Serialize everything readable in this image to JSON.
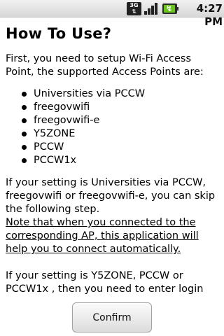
{
  "status_bar": {
    "network_type": "3G",
    "network_arrows": "⇅",
    "signal_level": 1.0,
    "battery_level": 0.95,
    "battery_color": "#69c51e",
    "time": "4:27 PM"
  },
  "page": {
    "title": "How To Use?",
    "intro": "First, you need to setup Wi-Fi Access Point, the supported Access Points are:",
    "access_points": [
      "Universities via PCCW",
      "freegovwifi",
      "freegovwifi-e",
      "Y5ZONE",
      "PCCW",
      "PCCW1x"
    ],
    "setting_universities": "If your setting is Universities via PCCW, freegovwifi or freegovwifi-e, you can skip the following step.",
    "note": "Note that when you connected to the corresponding AP, this application will help you to connect automatically.",
    "setting_login": "If your setting is Y5ZONE, PCCW or PCCW1x , then you need to enter login"
  },
  "actions": {
    "confirm_label": "Confirm"
  },
  "icons": {
    "network": "network-3g-icon",
    "signal": "signal-strength-icon",
    "battery": "battery-charging-icon"
  }
}
